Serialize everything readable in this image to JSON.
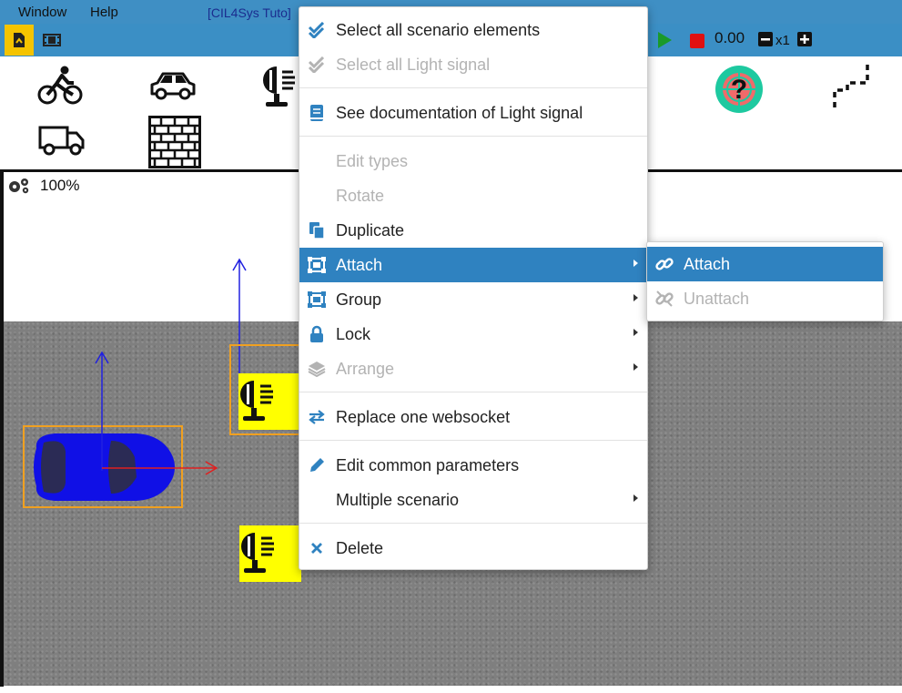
{
  "menubar": {
    "items": [
      {
        "label": "Window"
      },
      {
        "label": "Help"
      }
    ],
    "project_title": "[CIL4Sys Tuto]"
  },
  "toolbar": {
    "time_value": "0.00",
    "speed_value": "x1",
    "icons": [
      "pdf-export-icon",
      "film-icon",
      "play-icon",
      "stop-icon",
      "decrease-speed-icon",
      "increase-speed-icon"
    ],
    "colors": {
      "play": "#1a9a2a",
      "stop": "#e01010",
      "active_tab": "#f5c400"
    }
  },
  "palette": {
    "icons": [
      "cyclist-icon",
      "car-icon",
      "light-signal-icon",
      "truck-icon",
      "wall-icon",
      "radar-help-icon",
      "path-icon"
    ]
  },
  "canvas": {
    "zoom_label": "100%",
    "colors": {
      "road": "#7f7f7f",
      "car": "#1010e6",
      "selection": "#f0a020",
      "signal": "#ffff00"
    }
  },
  "context_menu": {
    "items": [
      {
        "label": "Select all scenario elements",
        "icon": "check-double-icon",
        "disabled": false
      },
      {
        "label": "Select all Light signal",
        "icon": "check-double-icon",
        "disabled": true
      },
      {
        "label": "See documentation of Light signal",
        "icon": "book-icon",
        "disabled": false
      },
      {
        "label": "Edit types",
        "disabled": true
      },
      {
        "label": "Rotate",
        "disabled": true
      },
      {
        "label": "Duplicate",
        "icon": "copy-icon",
        "disabled": false
      },
      {
        "label": "Attach",
        "icon": "object-group-icon",
        "disabled": false,
        "submenu": true,
        "active": true
      },
      {
        "label": "Group",
        "icon": "object-group-icon",
        "disabled": false,
        "submenu": true
      },
      {
        "label": "Lock",
        "icon": "lock-icon",
        "disabled": false,
        "submenu": true
      },
      {
        "label": "Arrange",
        "icon": "layers-icon",
        "disabled": true,
        "submenu": true
      },
      {
        "label": "Replace one websocket",
        "icon": "exchange-icon",
        "disabled": false
      },
      {
        "label": "Edit common parameters",
        "icon": "pencil-icon",
        "disabled": false
      },
      {
        "label": "Multiple scenario",
        "disabled": false,
        "submenu": true
      },
      {
        "label": "Delete",
        "icon": "close-icon",
        "disabled": false
      }
    ]
  },
  "submenu": {
    "items": [
      {
        "label": "Attach",
        "icon": "link-icon",
        "active": true
      },
      {
        "label": "Unattach",
        "icon": "unlink-icon",
        "disabled": true
      }
    ]
  }
}
